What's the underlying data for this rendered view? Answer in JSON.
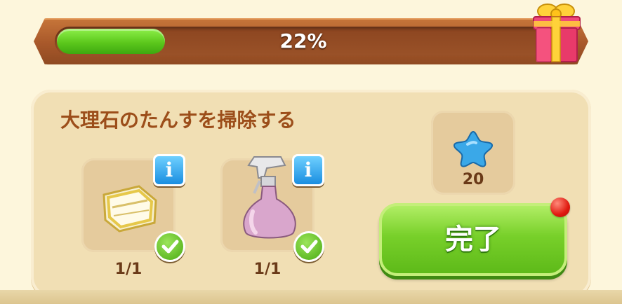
{
  "progress": {
    "percent_label": "22%",
    "value": 0.22
  },
  "task": {
    "title": "大理石のたんすを掃除する",
    "items": [
      {
        "icon": "cloth-icon",
        "count": "1/1",
        "info_label": "i",
        "completed": true
      },
      {
        "icon": "spray-bottle-icon",
        "count": "1/1",
        "info_label": "i",
        "completed": true
      }
    ],
    "reward": {
      "icon": "blue-star-icon",
      "count": "20"
    },
    "complete_button": {
      "label": "完了"
    }
  },
  "colors": {
    "progress_fill": "#5cc81c",
    "complete_button": "#78d02a",
    "title_text": "#9c4e1a",
    "info_button": "#1a8ee0"
  }
}
